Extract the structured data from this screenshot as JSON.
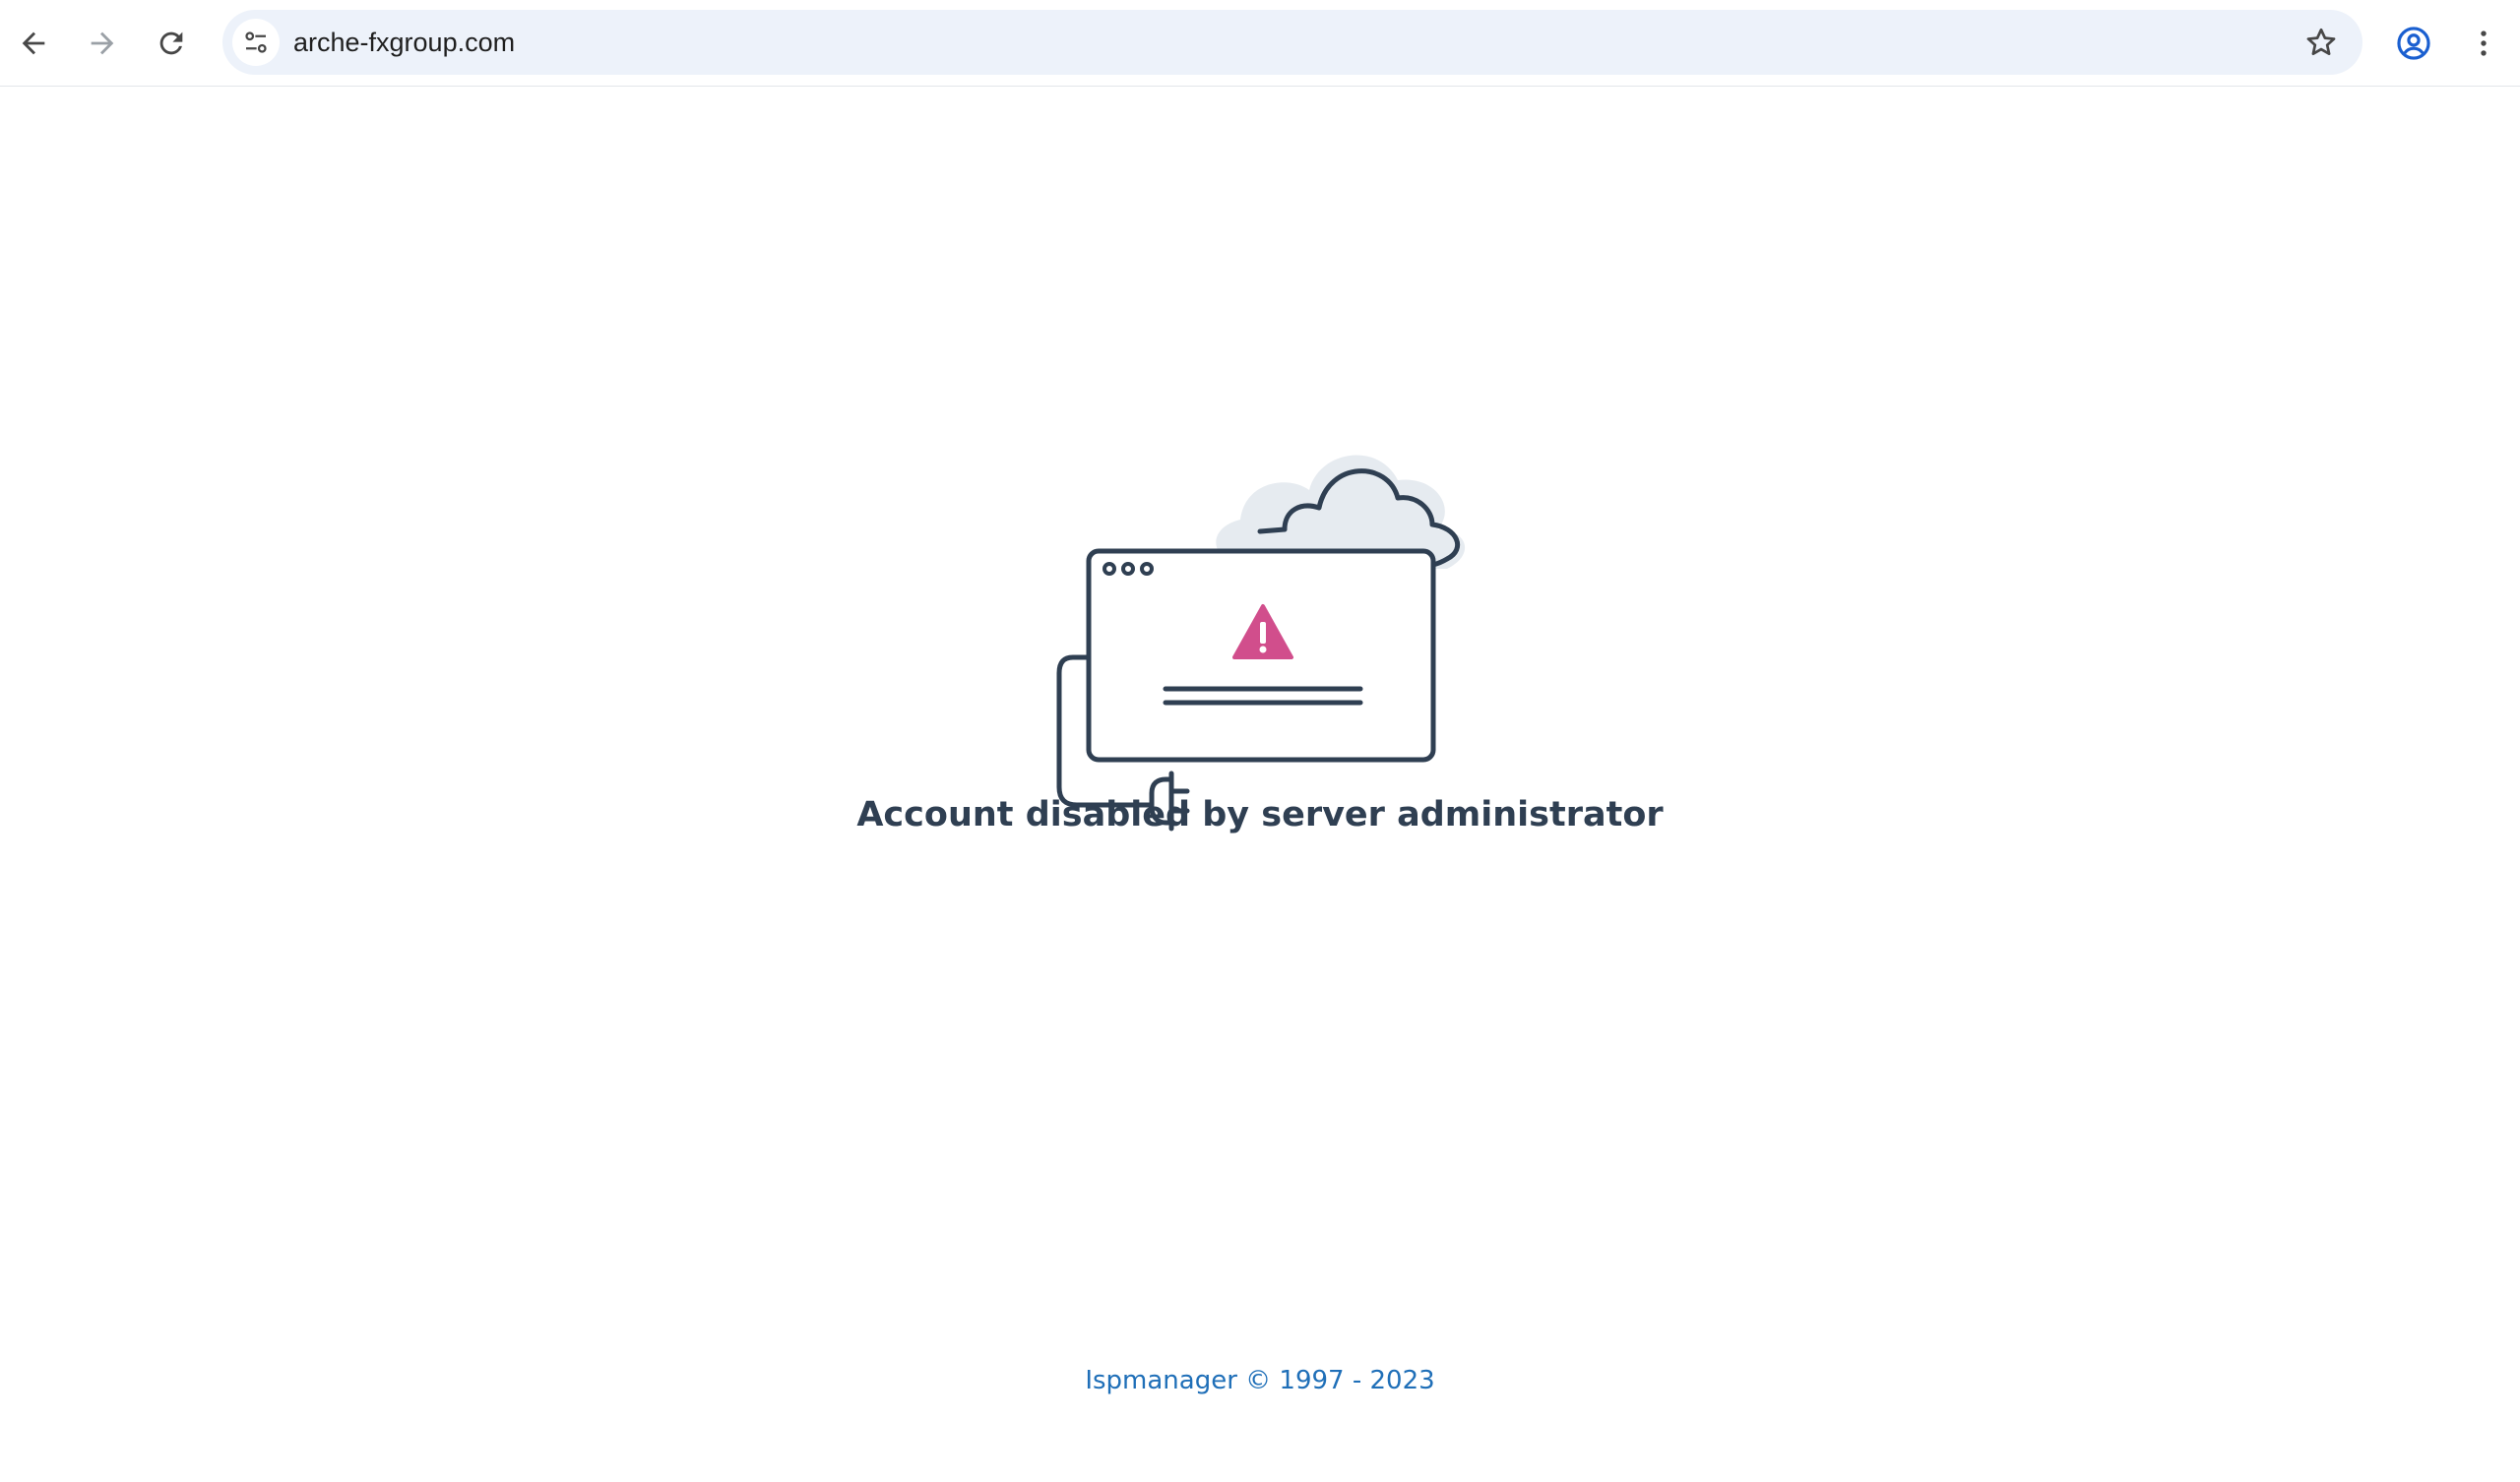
{
  "browser": {
    "url": "arche-fxgroup.com",
    "icons": {
      "back": "arrow-left-icon",
      "forward": "arrow-right-icon",
      "reload": "reload-icon",
      "site_info": "tune-icon",
      "bookmark": "star-icon",
      "profile": "account-circle-icon",
      "menu": "more-vertical-icon"
    }
  },
  "page": {
    "message": "Account disabled by server administrator",
    "footer": "Ispmanager © 1997 - 2023",
    "colors": {
      "text": "#2f3f52",
      "link": "#1f6fb8",
      "warning": "#d14e8c",
      "cloud": "#e6ebf0"
    }
  }
}
